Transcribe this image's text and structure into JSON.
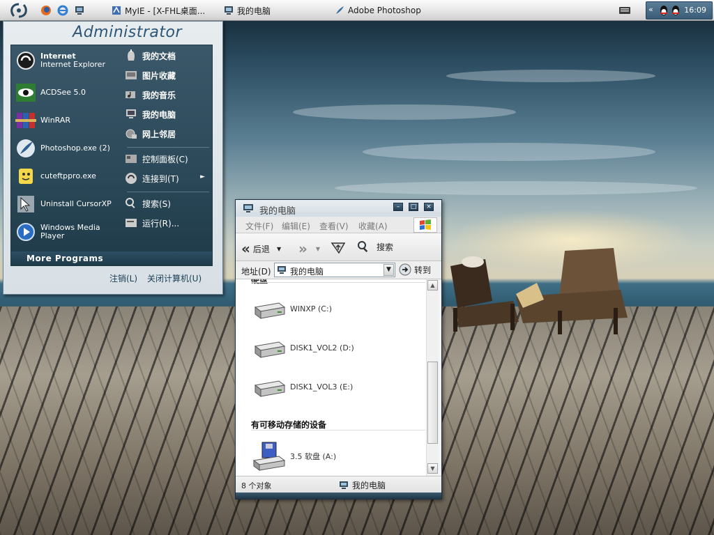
{
  "taskbar": {
    "start_icon": "start-orb-icon",
    "quicklaunch": [
      "firefox-icon",
      "internet-explorer-icon",
      "show-desktop-icon"
    ],
    "tasks": [
      {
        "label": "MyIE - [X-FHL桌面...",
        "icon": "myie-icon"
      },
      {
        "label": "我的电脑",
        "icon": "computer-icon"
      },
      {
        "label": "Adobe Photoshop",
        "icon": "photoshop-icon"
      }
    ],
    "keyboard_icon": "keyboard-icon",
    "tray_icons": [
      "tray-expand-icon",
      "qq-icon",
      "qq-icon-2"
    ],
    "clock": "16:09"
  },
  "startmenu": {
    "user": "Administrator",
    "programs": [
      {
        "title": "Internet",
        "subtitle": "Internet Explorer",
        "icon": "internet-explorer-icon"
      },
      {
        "title": "",
        "subtitle": "ACDSee 5.0",
        "icon": "acdsee-icon"
      },
      {
        "title": "",
        "subtitle": "WinRAR",
        "icon": "winrar-icon"
      },
      {
        "title": "",
        "subtitle": "Photoshop.exe (2)",
        "icon": "photoshop-icon"
      },
      {
        "title": "",
        "subtitle": "cuteftppro.exe",
        "icon": "cuteftp-icon"
      },
      {
        "title": "",
        "subtitle": "Uninstall CursorXP",
        "icon": "cursorxp-icon"
      },
      {
        "title": "",
        "subtitle": "Windows Media Player",
        "icon": "media-player-icon"
      }
    ],
    "places": [
      {
        "label": "我的文档",
        "icon": "documents-icon"
      },
      {
        "label": "图片收藏",
        "icon": "pictures-icon"
      },
      {
        "label": "我的音乐",
        "icon": "music-icon"
      },
      {
        "label": "我的电脑",
        "icon": "computer-icon"
      },
      {
        "label": "网上邻居",
        "icon": "network-icon"
      },
      {
        "label": "控制面板(C)",
        "icon": "control-panel-icon"
      },
      {
        "label": "连接到(T)",
        "icon": "connect-icon"
      },
      {
        "label": "搜索(S)",
        "icon": "search-icon"
      },
      {
        "label": "运行(R)...",
        "icon": "run-icon"
      }
    ],
    "more_programs": "More Programs",
    "logoff": "注销(L)",
    "shutdown": "关闭计算机(U)"
  },
  "explorer": {
    "title": "我的电脑",
    "menu": [
      "文件(F)",
      "编辑(E)",
      "查看(V)",
      "收藏(A)"
    ],
    "toolbar": {
      "back": "后退",
      "search": "搜索"
    },
    "address": {
      "label": "地址(D)",
      "value": "我的电脑",
      "go": "转到"
    },
    "groups": [
      {
        "title": "硬盘",
        "drives": [
          "WINXP (C:)",
          "DISK1_VOL2 (D:)",
          "DISK1_VOL3 (E:)"
        ]
      },
      {
        "title": "有可移动存储的设备",
        "drives": [
          "3.5 软盘 (A:)"
        ]
      }
    ],
    "status": {
      "count": "8 个对象",
      "location": "我的电脑"
    }
  },
  "colors": {
    "accent": "#2d5676",
    "taskbar": "#e6e6e6",
    "startmenu_panel": "#2a4858"
  }
}
